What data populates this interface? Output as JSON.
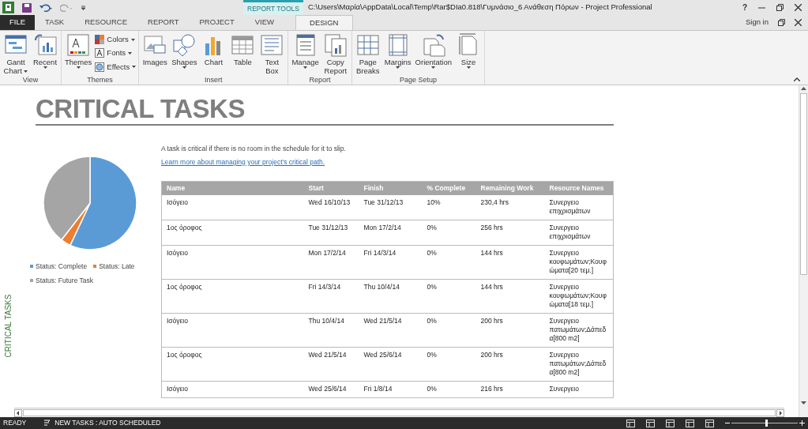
{
  "title_bar": {
    "context_group": "REPORT TOOLS",
    "title": "C:\\Users\\Μαρία\\AppData\\Local\\Temp\\Rar$DIa0.818\\Γυμνάσιο_6 Ανάθεση Πόρων - Project Professional",
    "help": "?",
    "sign_in": "Sign in"
  },
  "tabs": [
    {
      "label": "FILE",
      "kind": "file",
      "selected": false
    },
    {
      "label": "TASK",
      "kind": "normal",
      "selected": false
    },
    {
      "label": "RESOURCE",
      "kind": "normal",
      "selected": false
    },
    {
      "label": "REPORT",
      "kind": "normal",
      "selected": false
    },
    {
      "label": "PROJECT",
      "kind": "normal",
      "selected": false
    },
    {
      "label": "VIEW",
      "kind": "normal",
      "selected": false
    },
    {
      "label": "DESIGN",
      "kind": "normal",
      "selected": true
    }
  ],
  "ribbon": [
    {
      "label": "View",
      "buttons": [
        {
          "kind": "large",
          "lines": [
            "Gantt",
            "Chart"
          ],
          "dropdown": true
        },
        {
          "kind": "large",
          "lines": [
            "Recent"
          ],
          "dropdown": true
        }
      ]
    },
    {
      "label": "Themes",
      "buttons": [
        {
          "kind": "large",
          "lines": [
            "Themes"
          ],
          "dropdown": true
        },
        {
          "kind": "small",
          "lines": [
            "Colors"
          ],
          "dropdown": true
        },
        {
          "kind": "small",
          "lines": [
            "Fonts"
          ],
          "dropdown": true
        },
        {
          "kind": "small",
          "lines": [
            "Effects"
          ],
          "dropdown": true
        }
      ]
    },
    {
      "label": "Insert",
      "buttons": [
        {
          "kind": "large",
          "lines": [
            "Images"
          ],
          "dropdown": false
        },
        {
          "kind": "large",
          "lines": [
            "Shapes"
          ],
          "dropdown": true
        },
        {
          "kind": "large",
          "lines": [
            "Chart"
          ],
          "dropdown": false
        },
        {
          "kind": "large",
          "lines": [
            "Table"
          ],
          "dropdown": false
        },
        {
          "kind": "large",
          "lines": [
            "Text",
            "Box"
          ],
          "dropdown": false
        }
      ]
    },
    {
      "label": "Report",
      "buttons": [
        {
          "kind": "large",
          "lines": [
            "Manage"
          ],
          "dropdown": true
        },
        {
          "kind": "large",
          "lines": [
            "Copy",
            "Report"
          ],
          "dropdown": false
        }
      ]
    },
    {
      "label": "Page Setup",
      "buttons": [
        {
          "kind": "large",
          "lines": [
            "Page",
            "Breaks"
          ],
          "dropdown": false
        },
        {
          "kind": "large",
          "lines": [
            "Margins"
          ],
          "dropdown": true
        },
        {
          "kind": "large",
          "lines": [
            "Orientation"
          ],
          "dropdown": true
        },
        {
          "kind": "large",
          "lines": [
            "Size"
          ],
          "dropdown": true
        }
      ]
    }
  ],
  "report": {
    "title": "CRITICAL TASKS",
    "side_label": "CRITICAL TASKS",
    "description": "A task is critical if there is no room in the schedule for it to slip.",
    "link": "Learn more about managing your project's critical path.",
    "legend": [
      {
        "label": "Status: Complete",
        "color": "#5b9bd5"
      },
      {
        "label": "Status: Late",
        "color": "#ed7d31"
      },
      {
        "label": "Status: Future Task",
        "color": "#a5a5a5"
      }
    ],
    "table": {
      "columns": [
        "Name",
        "Start",
        "Finish",
        "% Complete",
        "Remaining Work",
        "Resource Names"
      ],
      "rows": [
        [
          "Ισόγειο",
          "Wed 16/10/13",
          "Tue 31/12/13",
          "10%",
          "230,4 hrs",
          "Συνεργειο επιχρισμάτων"
        ],
        [
          "1ος όροφος",
          "Tue 31/12/13",
          "Mon 17/2/14",
          "0%",
          "256 hrs",
          "Συνεργειο επιχρισμάτων"
        ],
        [
          "Ισόγειο",
          "Mon 17/2/14",
          "Fri 14/3/14",
          "0%",
          "144 hrs",
          "Συνεργειο κουφωμάτων;Κουφώματα[20 τεμ.]"
        ],
        [
          "1ος όροφος",
          "Fri 14/3/14",
          "Thu 10/4/14",
          "0%",
          "144 hrs",
          "Συνεργειο κουφωμάτων;Κουφώματα[18 τεμ.]"
        ],
        [
          "Ισόγειο",
          "Thu 10/4/14",
          "Wed 21/5/14",
          "0%",
          "200 hrs",
          "Συνεργειο πατωμάτων;Δάπεδα[800 m2]"
        ],
        [
          "1ος όροφος",
          "Wed 21/5/14",
          "Wed 25/6/14",
          "0%",
          "200 hrs",
          "Συνεργειο πατωμάτων;Δάπεδα[800 m2]"
        ],
        [
          "Ισόγειο",
          "Wed 25/6/14",
          "Fri 1/8/14",
          "0%",
          "216 hrs",
          "Συνεργειο"
        ]
      ]
    }
  },
  "status_bar": {
    "ready": "READY",
    "new_tasks": "NEW TASKS : AUTO SCHEDULED",
    "zoom": {
      "level": 0.52
    }
  }
}
